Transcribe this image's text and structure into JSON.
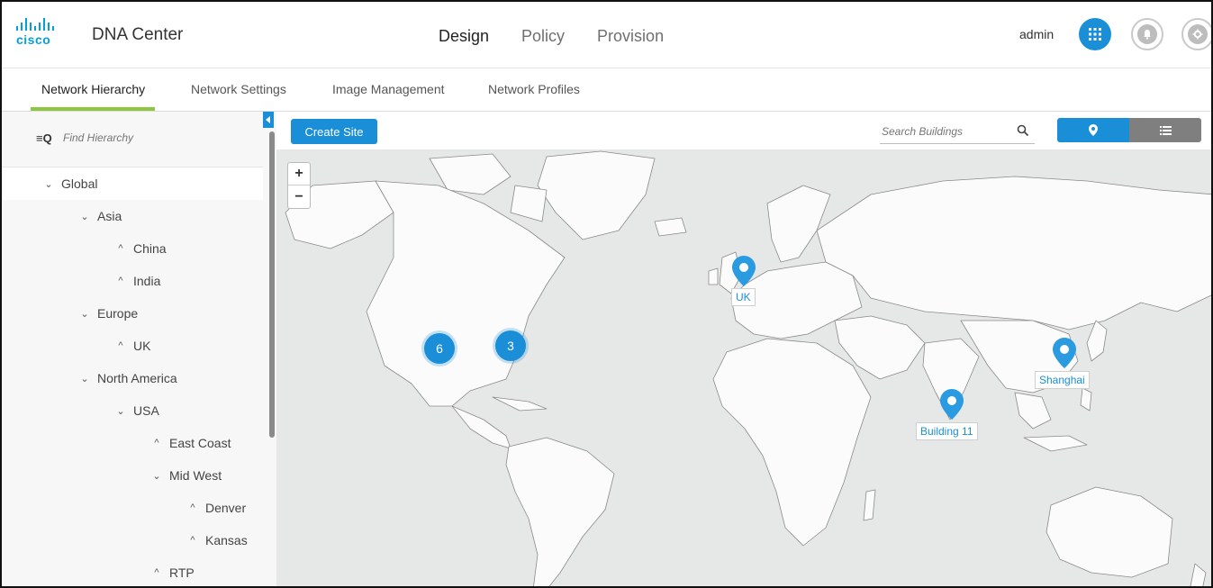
{
  "brand": {
    "logo_text": "cisco",
    "app_title": "DNA Center",
    "accent": "#1a8ed6",
    "tab_highlight": "#8dc63f"
  },
  "main_nav": [
    "Design",
    "Policy",
    "Provision"
  ],
  "header": {
    "user": "admin",
    "icons": [
      "apps-grid-icon",
      "bell-icon",
      "gear-icon"
    ]
  },
  "subtabs": [
    "Network Hierarchy",
    "Network Settings",
    "Image Management",
    "Network Profiles"
  ],
  "sidebar": {
    "search_placeholder": "Find Hierarchy",
    "tree": [
      {
        "label": "Global",
        "expanded": true
      },
      {
        "label": "Asia",
        "expanded": true
      },
      {
        "label": "China",
        "expanded": false
      },
      {
        "label": "India",
        "expanded": false
      },
      {
        "label": "Europe",
        "expanded": true
      },
      {
        "label": "UK",
        "expanded": false
      },
      {
        "label": "North America",
        "expanded": true
      },
      {
        "label": "USA",
        "expanded": true
      },
      {
        "label": "East Coast",
        "expanded": false
      },
      {
        "label": "Mid West",
        "expanded": true
      },
      {
        "label": "Denver",
        "expanded": false
      },
      {
        "label": "Kansas",
        "expanded": false
      },
      {
        "label": "RTP",
        "expanded": false
      }
    ]
  },
  "map_toolbar": {
    "create_site": "Create Site",
    "search_placeholder": "Search Buildings"
  },
  "map": {
    "clusters": [
      "6",
      "3"
    ],
    "pins": [
      "UK",
      "Shanghai",
      "Building 11"
    ]
  }
}
